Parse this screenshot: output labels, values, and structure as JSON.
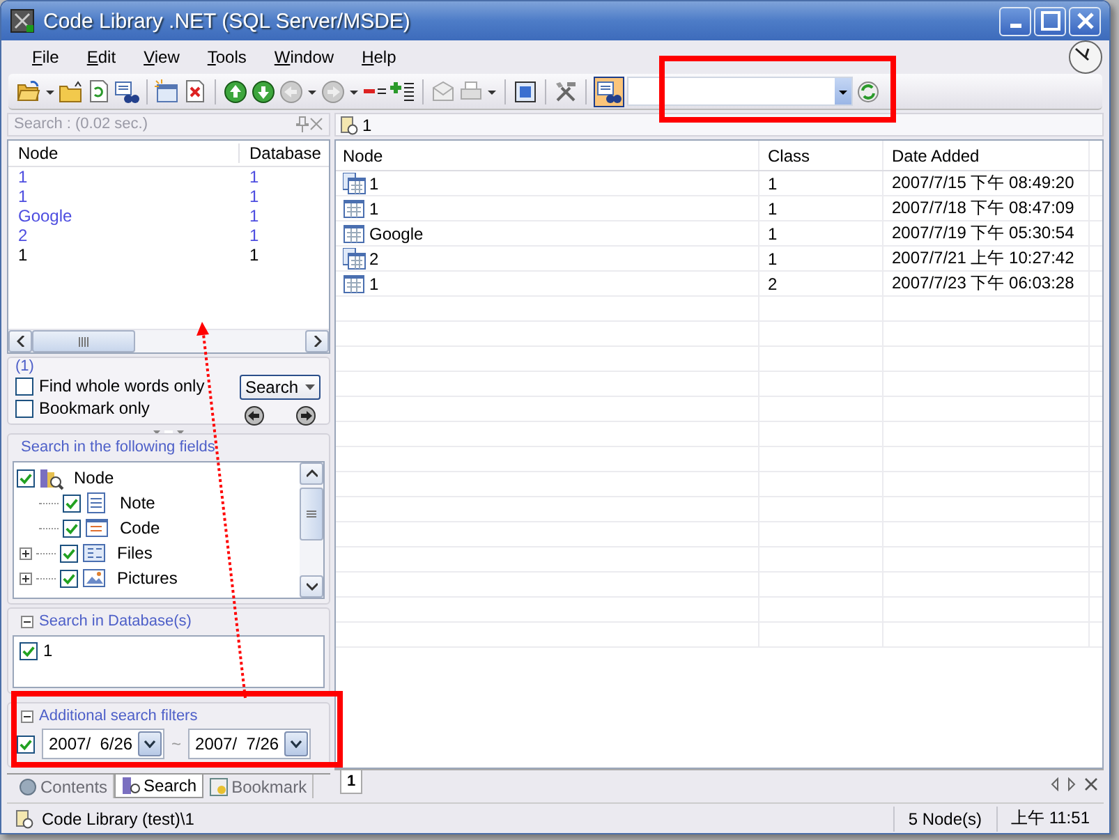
{
  "window": {
    "title": "Code Library .NET (SQL Server/MSDE)"
  },
  "menu": [
    "File",
    "Edit",
    "View",
    "Tools",
    "Window",
    "Help"
  ],
  "search_panel": {
    "title": "Search :  (0.02 sec.)",
    "results": {
      "columns": [
        "Node",
        "Database"
      ],
      "rows": [
        {
          "node": "1",
          "database": "1",
          "color": "#4d4de0"
        },
        {
          "node": "1",
          "database": "1",
          "color": "#4d4de0"
        },
        {
          "node": "Google",
          "database": "1",
          "color": "#4d4de0"
        },
        {
          "node": "2",
          "database": "1",
          "color": "#4d4de0"
        },
        {
          "node": "1",
          "database": "1",
          "color": "#000000"
        }
      ]
    },
    "match_count": "(1)",
    "options": [
      {
        "label": "Find whole words only",
        "checked": false
      },
      {
        "label": "Bookmark only",
        "checked": false
      }
    ],
    "search_button": "Search",
    "fields_group": {
      "title": "Search in the following fields",
      "tree": [
        {
          "label": "Node",
          "kind": "root",
          "checked": true,
          "expanded": true,
          "children": [
            {
              "label": "Note",
              "kind": "note",
              "checked": true
            },
            {
              "label": "Code",
              "kind": "code",
              "checked": true
            },
            {
              "label": "Files",
              "kind": "files",
              "checked": true,
              "expanded": false
            },
            {
              "label": "Pictures",
              "kind": "pictures",
              "checked": true,
              "expanded": false
            }
          ]
        }
      ]
    },
    "database_group": {
      "title": "Search in Database(s)",
      "expanded": true,
      "items": [
        {
          "label": "1",
          "checked": true
        }
      ]
    },
    "filters_group": {
      "title": "Additional search filters",
      "expanded": true,
      "checked": true,
      "from": "2007/  6/26",
      "separator": "~",
      "to": "2007/  7/26"
    },
    "tabs": [
      {
        "label": "Contents",
        "kind": "contents",
        "selected": false
      },
      {
        "label": "Search",
        "kind": "search",
        "selected": true
      },
      {
        "label": "Bookmark",
        "kind": "bookmark",
        "selected": false
      }
    ]
  },
  "document_tab": {
    "title": "1"
  },
  "table": {
    "columns": [
      "Node",
      "Class",
      "Date Added"
    ],
    "rows": [
      {
        "kind": "multi",
        "node": "1",
        "class": "1",
        "date_added": "2007/7/15 下午 08:49:20"
      },
      {
        "kind": "single",
        "node": "1",
        "class": "1",
        "date_added": "2007/7/18 下午 08:47:09"
      },
      {
        "kind": "single",
        "node": "Google",
        "class": "1",
        "date_added": "2007/7/19 下午 05:30:54"
      },
      {
        "kind": "multi",
        "node": "2",
        "class": "1",
        "date_added": "2007/7/21 上午 10:27:42"
      },
      {
        "kind": "single",
        "node": "1",
        "class": "2",
        "date_added": "2007/7/23 下午 06:03:28"
      }
    ]
  },
  "bottom_tabs": [
    {
      "label": "1",
      "selected": true
    }
  ],
  "status_bar": {
    "path": "Code Library (test)\\1",
    "count": "5 Node(s)",
    "time": "上午 11:51"
  }
}
